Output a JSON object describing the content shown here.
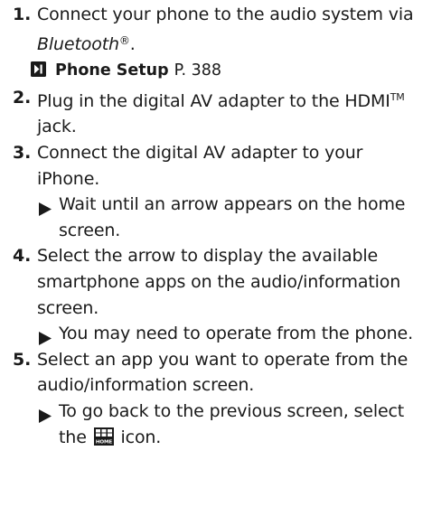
{
  "steps": [
    {
      "num": "1.",
      "text_pre": "Connect your phone to the audio system via ",
      "text_italic": "Bluetooth",
      "text_reg": "®",
      "text_post": ".",
      "ref": {
        "title": "Phone Setup",
        "page": "P. 388"
      }
    },
    {
      "num": "2.",
      "text_pre": "Plug in the digital AV adapter to the HDMI",
      "text_tm": "TM",
      "text_post": " jack."
    },
    {
      "num": "3.",
      "text": "Connect the digital AV adapter to your iPhone.",
      "result": "Wait until an arrow appears on the home screen."
    },
    {
      "num": "4.",
      "text": "Select the arrow to display the available smartphone apps on the audio/information screen.",
      "result": "You may need to operate from the phone."
    },
    {
      "num": "5.",
      "text": "Select an app you want to operate from the audio/information screen.",
      "result_pre": "To go back to the previous screen, select the ",
      "result_icon_label": "HOME",
      "result_post": " icon."
    }
  ],
  "icons": {
    "ref_arrow": "ref-arrow-icon",
    "result_marker": "triangle-icon",
    "home": "home-icon"
  },
  "colors": {
    "text": "#1a1a1a",
    "icon_dark": "#1a1a1a"
  }
}
